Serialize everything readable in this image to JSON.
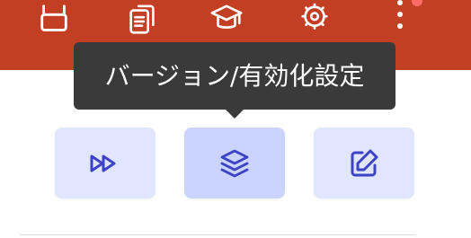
{
  "colors": {
    "header": "#c33f24",
    "tooltip_bg": "#3a3a3a",
    "tooltip_text": "#ffffff",
    "button_bg": "#e1e6ff",
    "button_bg_active": "#cbd4ff",
    "button_icon": "#3d43c5",
    "notification": "#ff6b6b"
  },
  "header": {
    "icons": [
      "archive-icon",
      "documents-icon",
      "graduation-cap-icon",
      "settings-gear-icon",
      "more-vertical-icon"
    ]
  },
  "tooltip": {
    "text": "バージョン/有効化設定"
  },
  "actions": [
    {
      "icon": "fast-forward-icon",
      "active": false
    },
    {
      "icon": "layers-icon",
      "active": true
    },
    {
      "icon": "edit-icon",
      "active": false
    }
  ]
}
